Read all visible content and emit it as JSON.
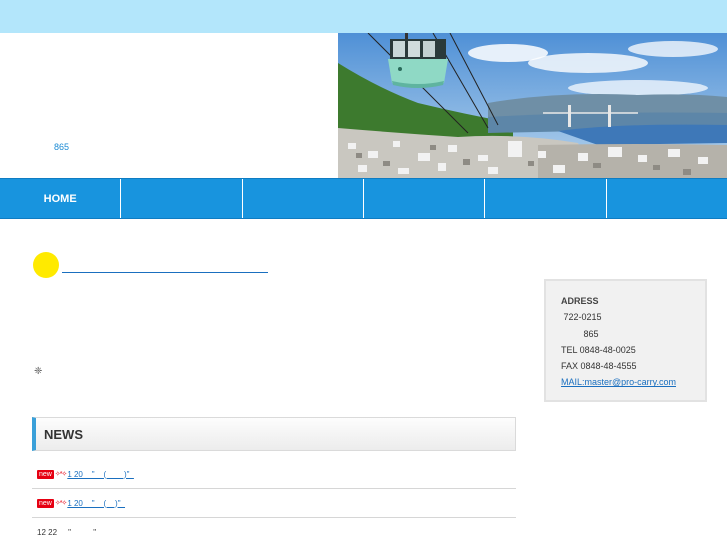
{
  "header": {
    "address_fragment": "865"
  },
  "nav": {
    "items": [
      "HOME",
      "",
      "",
      "",
      "",
      ""
    ]
  },
  "content": {
    "icon_glyph": "❈"
  },
  "news": {
    "title": "NEWS",
    "items": [
      {
        "badge": "new",
        "sparkle": "✧*✧",
        "text": "1 20    \"    (        )\"  ",
        "link": true
      },
      {
        "badge": "new",
        "sparkle": "✧*✧",
        "text": "1 20    \"    (    )\"  ",
        "link": true
      },
      {
        "badge": "",
        "sparkle": "",
        "text": "12 22     \"          \"",
        "link": false
      }
    ]
  },
  "info": {
    "heading": "ADRESS",
    "postal": " 722-0215",
    "address": "         865",
    "tel": "TEL 0848-48-0025",
    "fax": "FAX 0848-48-4555",
    "mail": "MAIL:master@pro-carry.com"
  },
  "colors": {
    "topbar": "#b3e6fb",
    "nav": "#1894de",
    "accent_dot": "#ffea00",
    "badge": "#e60012",
    "link": "#1a6fbf"
  }
}
